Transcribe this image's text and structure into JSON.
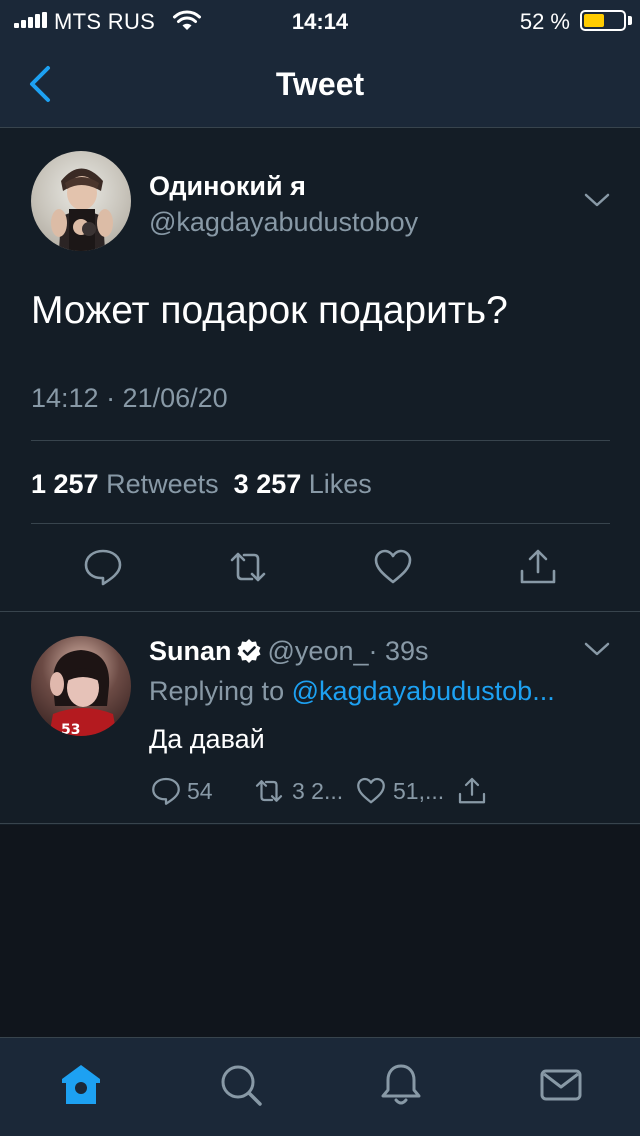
{
  "status_bar": {
    "carrier": "MTS RUS",
    "time": "14:14",
    "battery": "52 %",
    "battery_level": 0.52,
    "battery_color": "#ffcc00"
  },
  "nav": {
    "title": "Tweet",
    "back_icon": "chevron-left-icon"
  },
  "tweet": {
    "author_name": "Одинокий я",
    "author_handle": "@kagdayabudustoboy",
    "text": "Может подарок подарить?",
    "timestamp": "14:12 · 21/06/20",
    "retweets_count": "1 257",
    "retweets_label": "Retweets",
    "likes_count": "3 257",
    "likes_label": "Likes",
    "actions": [
      "reply-icon",
      "retweet-icon",
      "like-icon",
      "share-icon"
    ]
  },
  "reply": {
    "author_name": "Sunan",
    "author_handle": "@yeon_",
    "age": "· 39s",
    "replying_prefix": "Replying to",
    "replying_mention": "@kagdayabudustob...",
    "text": "Да давай",
    "reply_count": "54",
    "retweet_count": "3 2...",
    "like_count": "51,..."
  },
  "tabs": [
    "home-icon",
    "search-icon",
    "notifications-icon",
    "messages-icon"
  ],
  "colors": {
    "accent": "#1da1f2",
    "background": "#141d26",
    "secondary_text": "#8899a6"
  }
}
